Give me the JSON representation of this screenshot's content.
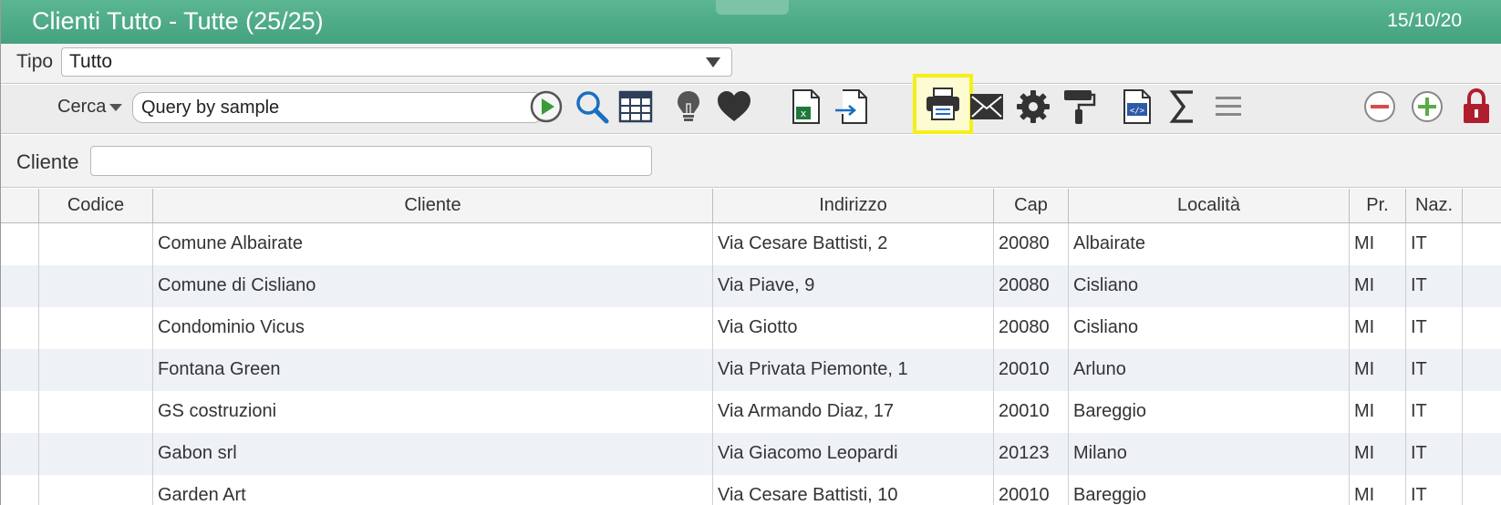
{
  "window": {
    "title": "Clienti Tutto - Tutte (25/25)",
    "date": "15/10/20"
  },
  "tipo": {
    "label": "Tipo",
    "value": "Tutto"
  },
  "search": {
    "label": "Cerca",
    "value": "Query by sample"
  },
  "toolbar": {
    "icons": [
      "run-icon",
      "search-icon",
      "table-icon",
      "lightbulb-icon",
      "heart-icon",
      "excel-export-icon",
      "import-icon",
      "print-icon",
      "mail-icon",
      "settings-icon",
      "paint-roller-icon",
      "code-file-icon",
      "sum-icon",
      "menu-icon",
      "remove-icon",
      "add-icon",
      "lock-icon"
    ],
    "highlighted": "print-icon",
    "colors": {
      "run": "#3a9a3a",
      "search": "#1a6fc0",
      "excel": "#1e7a3a",
      "remove": "#d94a4a",
      "add": "#5aaa48",
      "lock": "#b01e2e",
      "highlight": "#f5ef1a"
    }
  },
  "filter": {
    "cliente_label": "Cliente",
    "cliente_value": ""
  },
  "table": {
    "columns": [
      "",
      "Codice",
      "Cliente",
      "Indirizzo",
      "Cap",
      "Località",
      "Pr.",
      "Naz."
    ],
    "rows": [
      [
        "",
        "",
        "Comune Albairate",
        "Via Cesare Battisti, 2",
        "20080",
        "Albairate",
        "MI",
        "IT"
      ],
      [
        "",
        "",
        "Comune di Cisliano",
        "Via Piave, 9",
        "20080",
        "Cisliano",
        "MI",
        "IT"
      ],
      [
        "",
        "",
        "Condominio Vicus",
        "Via Giotto",
        "20080",
        "Cisliano",
        "MI",
        "IT"
      ],
      [
        "",
        "",
        "Fontana Green",
        "Via Privata Piemonte, 1",
        "20010",
        "Arluno",
        "MI",
        "IT"
      ],
      [
        "",
        "",
        "GS costruzioni",
        "Via Armando Diaz, 17",
        "20010",
        "Bareggio",
        "MI",
        "IT"
      ],
      [
        "",
        "",
        "Gabon srl",
        "Via Giacomo Leopardi",
        "20123",
        "Milano",
        "MI",
        "IT"
      ],
      [
        "",
        "",
        "Garden Art",
        "Via Cesare Battisti, 10",
        "20010",
        "Bareggio",
        "MI",
        "IT"
      ]
    ]
  }
}
